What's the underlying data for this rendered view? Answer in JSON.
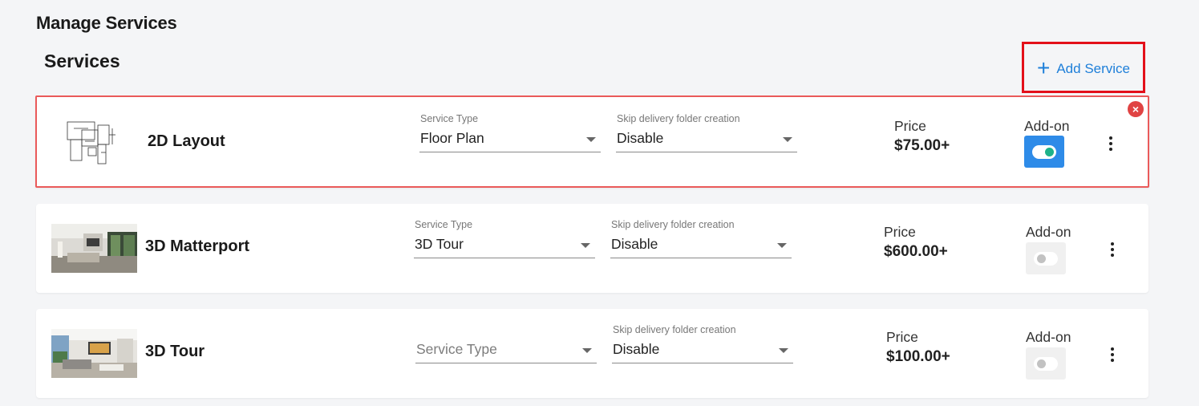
{
  "page": {
    "heading": "Manage Services",
    "section_title": "Services",
    "add_button": {
      "icon": "plus-icon",
      "label": "Add Service"
    }
  },
  "services": [
    {
      "name": "2D Layout",
      "thumbnail": "floor-plan-image",
      "service_type": {
        "label": "Service Type",
        "value": "Floor Plan",
        "placeholder": ""
      },
      "skip_folder": {
        "label": "Skip delivery folder creation",
        "value": "Disable"
      },
      "price_label": "Price",
      "price": "$75.00+",
      "addon_label": "Add-on",
      "addon_enabled": true,
      "selected": true
    },
    {
      "name": "3D Matterport",
      "thumbnail": "interior-photo",
      "service_type": {
        "label": "Service Type",
        "value": "3D Tour",
        "placeholder": ""
      },
      "skip_folder": {
        "label": "Skip delivery folder creation",
        "value": "Disable"
      },
      "price_label": "Price",
      "price": "$600.00+",
      "addon_label": "Add-on",
      "addon_enabled": false,
      "selected": false
    },
    {
      "name": "3D Tour",
      "thumbnail": "interior-photo",
      "service_type": {
        "label": "",
        "value": "",
        "placeholder": "Service Type"
      },
      "skip_folder": {
        "label": "Skip delivery folder creation",
        "value": "Disable"
      },
      "price_label": "Price",
      "price": "$100.00+",
      "addon_label": "Add-on",
      "addon_enabled": false,
      "selected": false
    }
  ],
  "colors": {
    "accent_blue": "#1e7fd9",
    "toggle_on_bg": "#2e8be8",
    "toggle_knob_on": "#1eb28a",
    "selected_border": "#ea5a5a",
    "remove_icon": "#e04343",
    "highlight_box": "#e3101a"
  }
}
